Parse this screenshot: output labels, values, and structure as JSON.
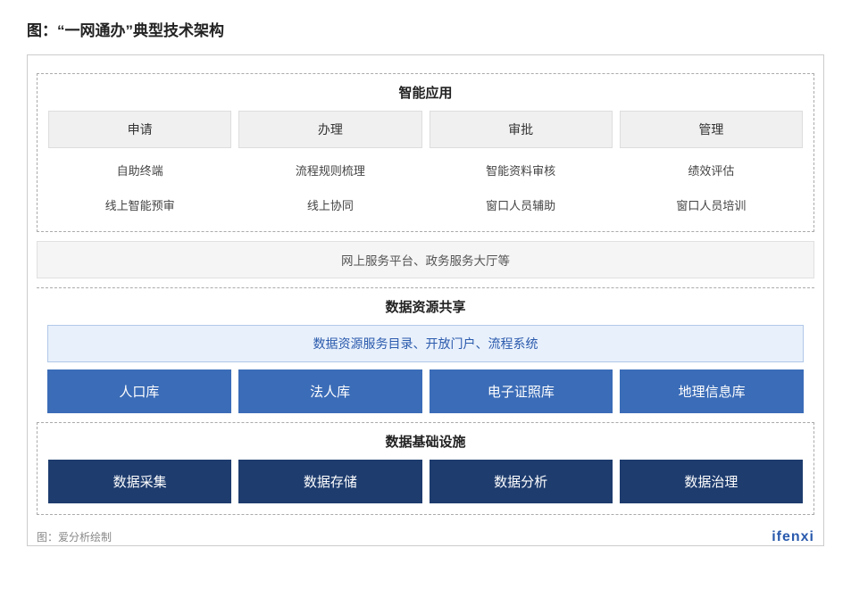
{
  "title": "图：“一网通办”典型技术架构",
  "智能应用": {
    "label": "智能应用",
    "headers": [
      "申请",
      "办理",
      "审批",
      "管理"
    ],
    "contents": [
      [
        "自助终端",
        "流程规则梳理",
        "智能资料审核",
        "绩效评估"
      ],
      [
        "线上智能预审",
        "线上协同",
        "窗口人员辅助",
        "窗口人员培训"
      ]
    ]
  },
  "service_platform": "网上服务平台、政务服务大厅等",
  "数据资源共享": {
    "label": "数据资源共享",
    "resource_bar": "数据资源服务目录、开放门户、流程系统",
    "stores": [
      "人口库",
      "法人库",
      "电子证照库",
      "地理信息库"
    ]
  },
  "数据基础设施": {
    "label": "数据基础设施",
    "items": [
      "数据采集",
      "数据存储",
      "数据分析",
      "数据治理"
    ]
  },
  "footer": {
    "left": "图：爱分析绘制",
    "right": "ifenxi"
  }
}
